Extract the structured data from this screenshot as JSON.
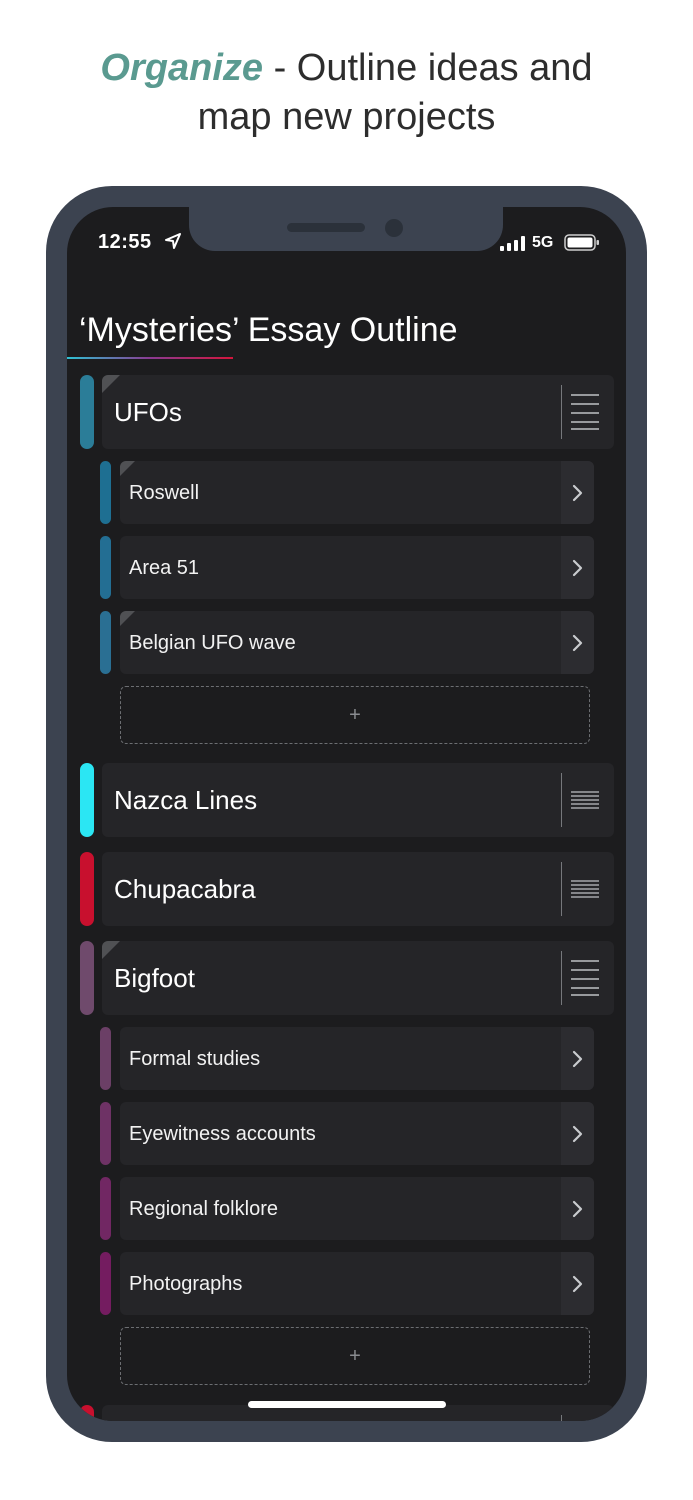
{
  "headline": {
    "accent": "Organize",
    "rest_line1": " - Outline ideas and",
    "line2": "map new projects"
  },
  "status_bar": {
    "time": "12:55",
    "network": "5G"
  },
  "outline": {
    "title": "‘Mysteries’ Essay Outline",
    "topics": [
      {
        "label": "UFOs",
        "color": "#2b7d98",
        "subtopics": [
          "Roswell",
          "Area 51",
          "Belgian UFO wave"
        ],
        "add_label": "+"
      },
      {
        "label": "Nazca Lines",
        "color": "#2be6f3"
      },
      {
        "label": "Chupacabra",
        "color": "#c8102e"
      },
      {
        "label": "Bigfoot",
        "color": "#6f4a6c",
        "subtopics": [
          "Formal studies",
          "Eyewitness accounts",
          "Regional folklore",
          "Photographs"
        ],
        "add_label": "+"
      }
    ]
  },
  "colors": {
    "accent_headline": "#5a9a90",
    "phone_frame": "#3c4350",
    "screen_bg": "#1c1c1e",
    "row_bg": "#252528"
  }
}
